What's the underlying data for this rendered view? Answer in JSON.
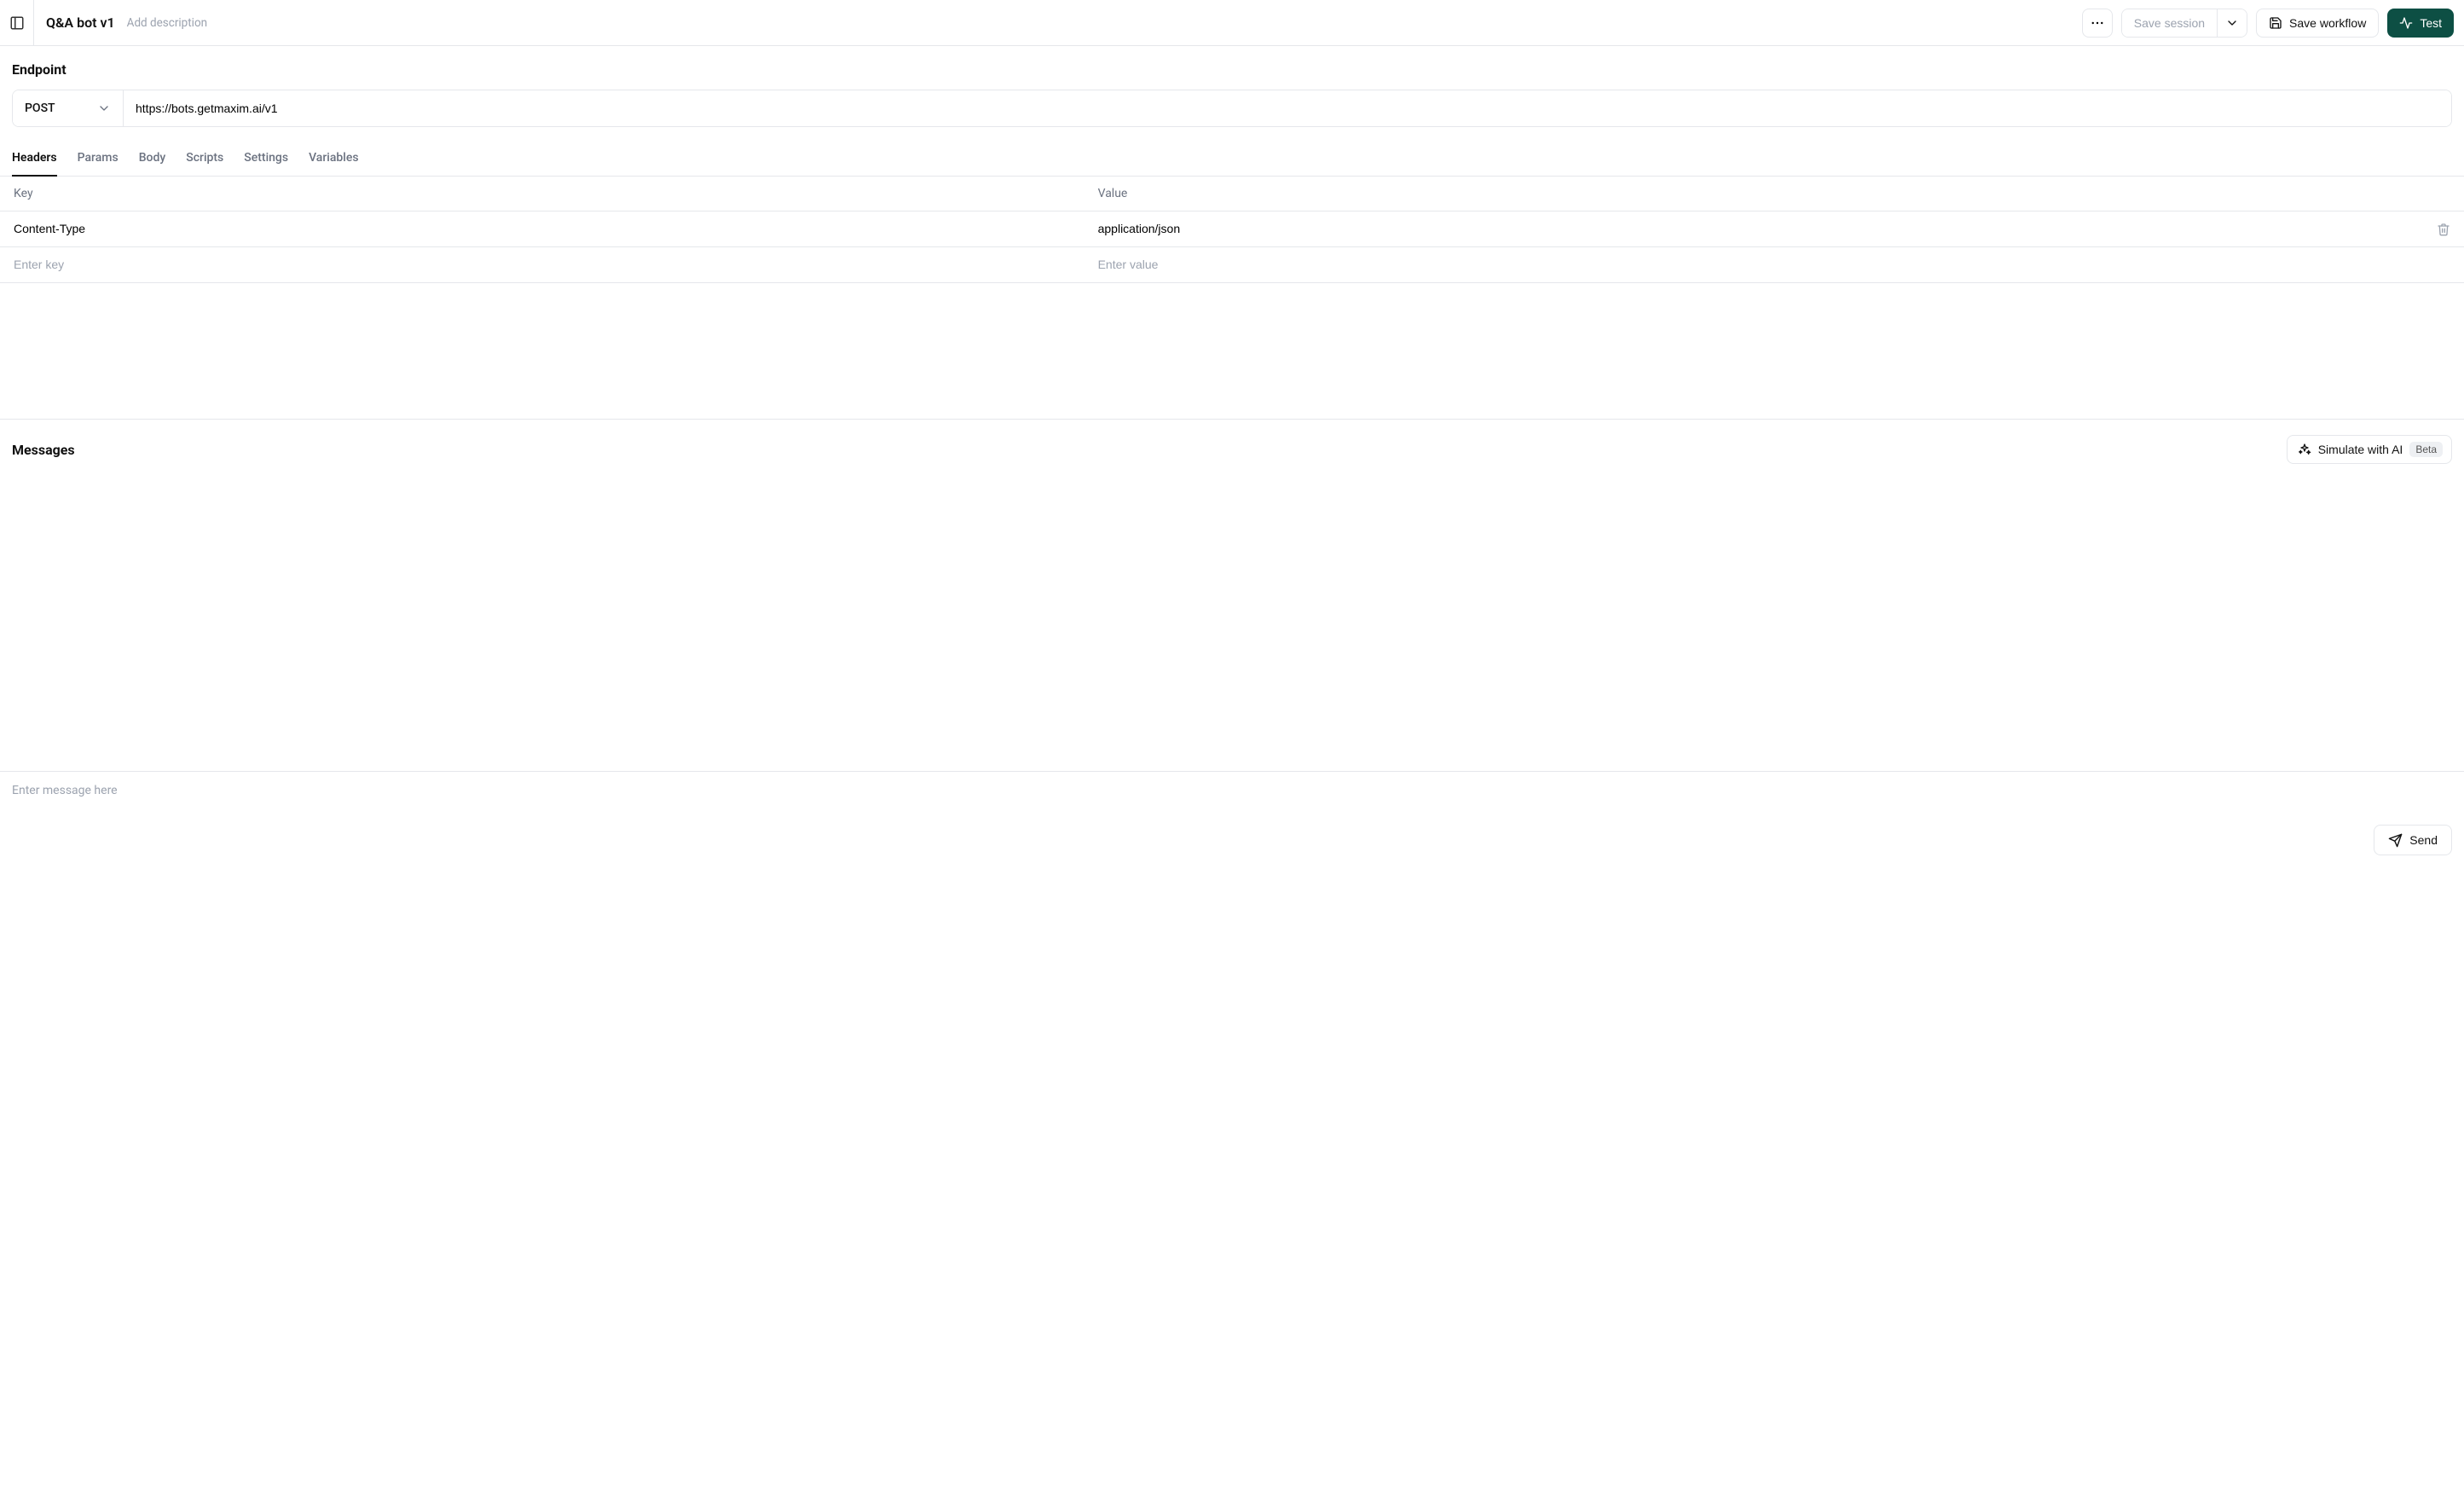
{
  "header": {
    "title": "Q&A bot v1",
    "description_placeholder": "Add description",
    "save_session_label": "Save session",
    "save_workflow_label": "Save workflow",
    "test_label": "Test"
  },
  "endpoint": {
    "section_title": "Endpoint",
    "method": "POST",
    "url": "https://bots.getmaxim.ai/v1",
    "tabs": [
      "Headers",
      "Params",
      "Body",
      "Scripts",
      "Settings",
      "Variables"
    ],
    "active_tab_index": 0,
    "table": {
      "col_key_label": "Key",
      "col_value_label": "Value",
      "rows": [
        {
          "key": "Content-Type",
          "value": "application/json"
        }
      ],
      "new_key_placeholder": "Enter key",
      "new_value_placeholder": "Enter value"
    }
  },
  "messages": {
    "section_title": "Messages",
    "simulate_label": "Simulate with AI",
    "simulate_badge": "Beta",
    "input_placeholder": "Enter message here",
    "send_label": "Send"
  }
}
